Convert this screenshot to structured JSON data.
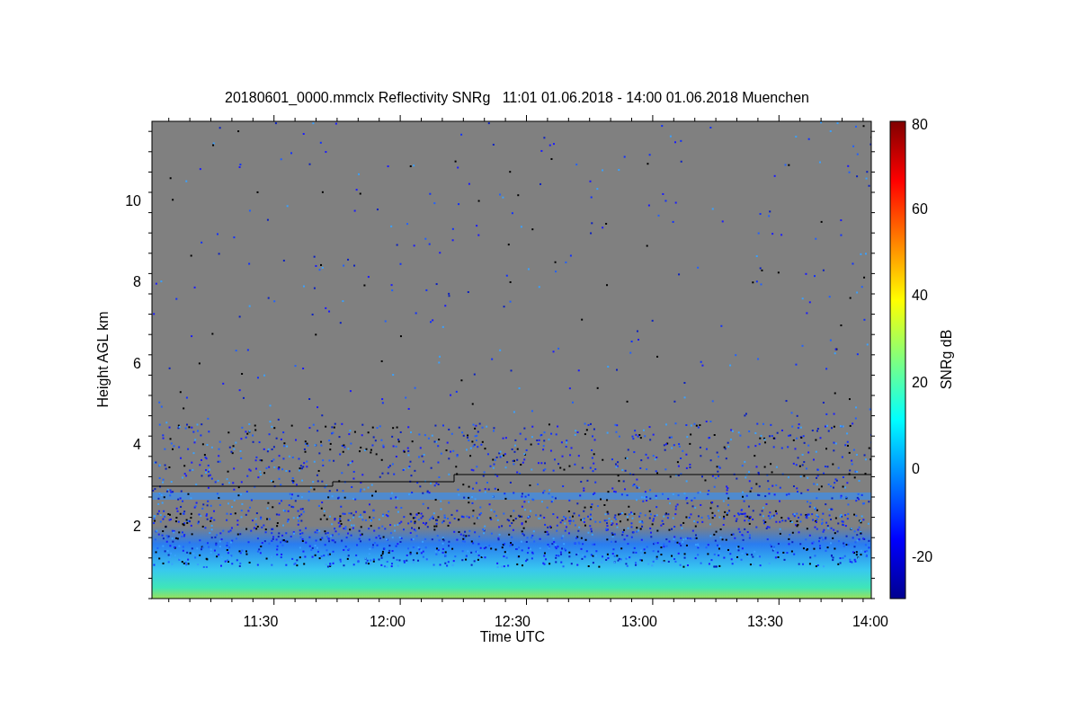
{
  "chart": {
    "title": "20180601_0000.mmclx Reflectivity SNRg   11:01 01.06.2018 - 14:00 01.06.2018 Muenchen",
    "xlabel": "Time UTC",
    "ylabel": "Height AGL km",
    "x_ticks": [
      "11:30",
      "12:00",
      "12:30",
      "13:00",
      "13:30",
      "14:00"
    ],
    "y_ticks": [
      "10",
      "8",
      "6",
      "4",
      "2"
    ],
    "colorbar": {
      "label": "SNRg dB",
      "ticks": [
        "80",
        "60",
        "40",
        "20",
        "0",
        "-20"
      ]
    }
  }
}
